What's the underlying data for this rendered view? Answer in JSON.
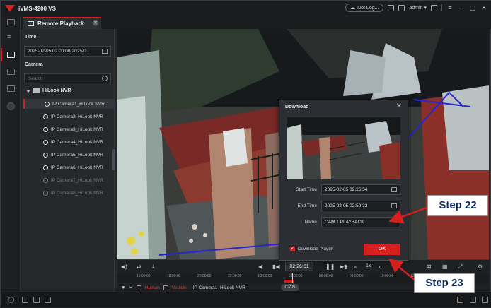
{
  "app": {
    "title": "iVMS-4200 VS"
  },
  "titlebar": {
    "cloud_status": "Not Log...",
    "user": "admin"
  },
  "tab": {
    "label": "Remote Playback"
  },
  "sidebar": {
    "time_label": "Time",
    "time_range": "2025-02-05 02:00:00-2025-0...",
    "camera_label": "Camera",
    "search_placeholder": "Search",
    "nvr_name": "HiLook NVR",
    "cameras": [
      {
        "label": "IP Camera1_HiLook NVR",
        "status": "selected"
      },
      {
        "label": "IP Camera2_HiLook NVR",
        "status": "online"
      },
      {
        "label": "IP Camera3_HiLook NVR",
        "status": "online"
      },
      {
        "label": "IP Camera4_HiLook NVR",
        "status": "online"
      },
      {
        "label": "IP Camera5_HiLook NVR",
        "status": "online"
      },
      {
        "label": "IP Camera6_HiLook NVR",
        "status": "online"
      },
      {
        "label": "IP Camera7_HiLook NVR",
        "status": "offline"
      },
      {
        "label": "IP Camera8_HiLook NVR",
        "status": "offline"
      }
    ]
  },
  "controls": {
    "current_time": "02:26:51",
    "speed": "1x"
  },
  "timeline": {
    "ticks": [
      "16:00:00",
      "18:00:00",
      "20:00:00",
      "22:00:00",
      "02:00:00",
      "04:00:00",
      "06:00:00",
      "08:00:00",
      "10:00:00",
      "12:00:00"
    ],
    "date": "02/05"
  },
  "filters": {
    "human": "Human",
    "vehicle": "Vehicle",
    "camera": "IP Camera1_HiLook NVR"
  },
  "dialog": {
    "title": "Download",
    "start_label": "Start Time",
    "start_value": "2025-02-05 02:26:54",
    "end_label": "End Time",
    "end_value": "2025-02-05 02:59:32",
    "name_label": "Name",
    "name_value": "CAM 1 PLAYBACK",
    "download_player": "Download Player",
    "ok": "OK"
  },
  "annotations": {
    "step22": "Step 22",
    "step23": "Step 23"
  },
  "colors": {
    "accent": "#d62020",
    "callout_text": "#0d2a5e",
    "arrow": "#d62020"
  }
}
